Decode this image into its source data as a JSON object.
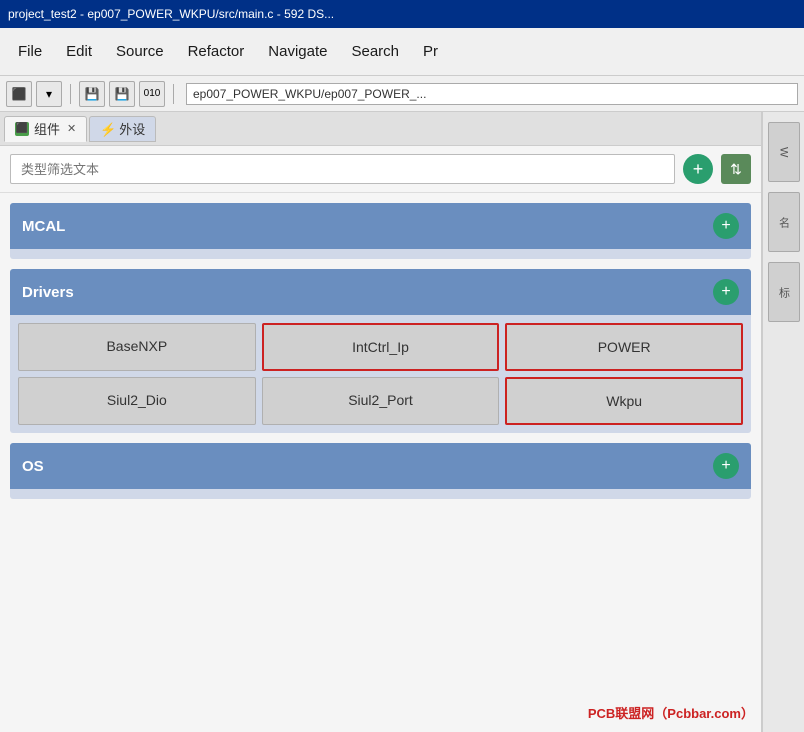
{
  "title_bar": {
    "text": "project_test2 - ep007_POWER_WKPU/src/main.c - 592 DS..."
  },
  "menu_bar": {
    "items": [
      "File",
      "Edit",
      "Source",
      "Refactor",
      "Navigate",
      "Search",
      "Pr"
    ]
  },
  "toolbar": {
    "breadcrumb": "ep007_POWER_WKPU/ep007_POWER_..."
  },
  "tabs": [
    {
      "id": "components",
      "icon": "component-icon",
      "label": "组件",
      "closable": true,
      "active": true
    },
    {
      "id": "external",
      "icon": "usb-icon",
      "label": "外设",
      "closable": false,
      "active": false
    }
  ],
  "filter": {
    "placeholder": "类型筛选文本",
    "add_label": "+",
    "sort_label": "⇅"
  },
  "categories": [
    {
      "id": "mcal",
      "label": "MCAL",
      "add_btn": "+",
      "items": []
    },
    {
      "id": "drivers",
      "label": "Drivers",
      "add_btn": "+",
      "items": [
        {
          "id": "basenxp",
          "label": "BaseNXP",
          "highlighted": false
        },
        {
          "id": "intctrl_ip",
          "label": "IntCtrl_Ip",
          "highlighted": true
        },
        {
          "id": "power",
          "label": "POWER",
          "highlighted": true
        },
        {
          "id": "siul2_dio",
          "label": "Siul2_Dio",
          "highlighted": false
        },
        {
          "id": "siul2_port",
          "label": "Siul2_Port",
          "highlighted": false
        },
        {
          "id": "wkpu",
          "label": "Wkpu",
          "highlighted": true
        }
      ]
    },
    {
      "id": "os",
      "label": "OS",
      "add_btn": "+",
      "items": []
    }
  ],
  "right_panel": {
    "btn1": "W",
    "btn2": "名",
    "btn3": "标"
  },
  "watermark": {
    "text": "PCB联盟网（Pcbbar.com）"
  }
}
